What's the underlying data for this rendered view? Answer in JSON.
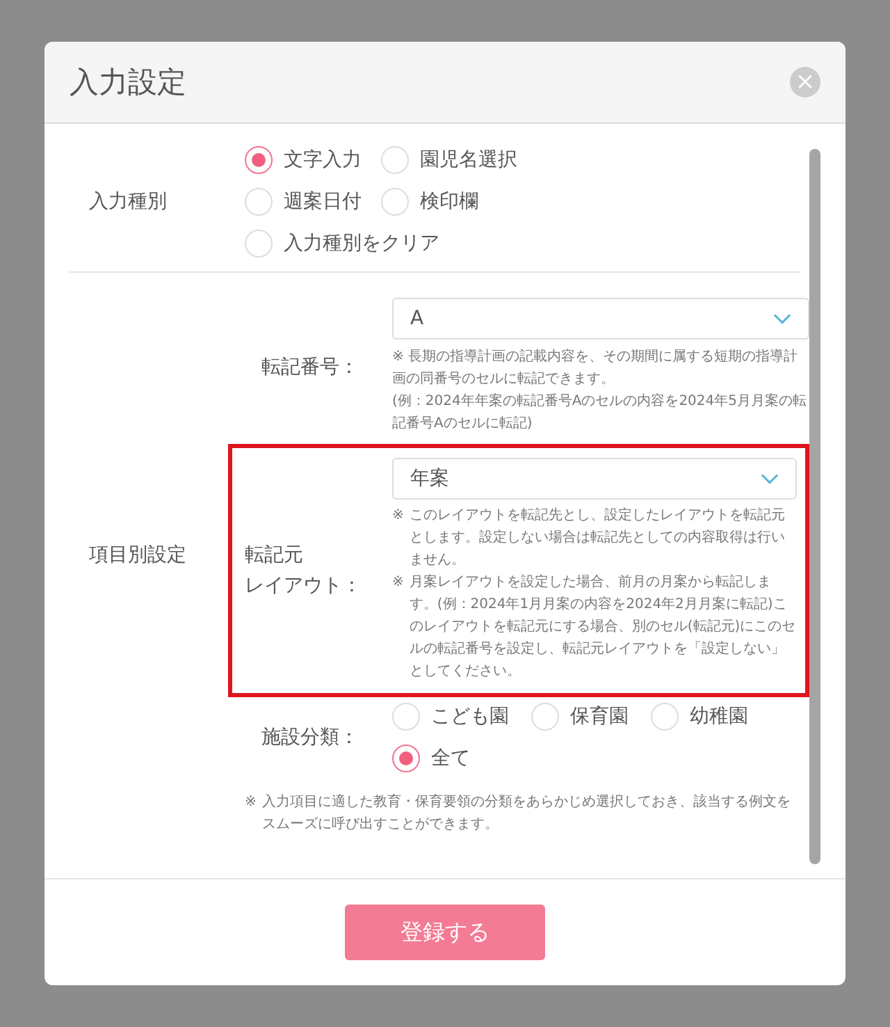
{
  "dialog": {
    "title": "入力設定",
    "close_icon": "×"
  },
  "input_type": {
    "label": "入力種別",
    "options": [
      {
        "label": "文字入力",
        "selected": true
      },
      {
        "label": "園児名選択",
        "selected": false
      },
      {
        "label": "週案日付",
        "selected": false
      },
      {
        "label": "検印欄",
        "selected": false
      },
      {
        "label": "入力種別をクリア",
        "selected": false
      }
    ]
  },
  "item_settings": {
    "label": "項目別設定",
    "transfer_number": {
      "label": "転記番号：",
      "value": "A",
      "notes": [
        "※ 長期の指導計画の記載内容を、その期間に属する短期の指導計画の同番号のセルに転記できます。",
        "(例：2024年年案の転記番号Aのセルの内容を2024年5月月案の転記番号Aのセルに転記)"
      ]
    },
    "source_layout": {
      "label_lines": [
        "転記元",
        "レイアウト："
      ],
      "value": "年案",
      "highlighted": true,
      "notes": [
        {
          "mark": "※",
          "text": "このレイアウトを転記先とし、設定したレイアウトを転記元とします。設定しない場合は転記先としての内容取得は行いません。"
        },
        {
          "mark": "※",
          "text": "月案レイアウトを設定した場合、前月の月案から転記します。(例：2024年1月月案の内容を2024年2月月案に転記)このレイアウトを転記元にする場合、別のセル(転記元)にこのセルの転記番号を設定し、転記元レイアウトを「設定しない」としてください。"
        }
      ]
    },
    "facility": {
      "label": "施設分類：",
      "options": [
        {
          "label": "こども園",
          "selected": false
        },
        {
          "label": "保育園",
          "selected": false
        },
        {
          "label": "幼稚園",
          "selected": false
        },
        {
          "label": "全て",
          "selected": true
        }
      ]
    },
    "note": {
      "mark": "※",
      "text": "入力項目に適した教育・保育要領の分類をあらかじめ選択しておき、該当する例文をスムーズに呼び出すことができます。"
    }
  },
  "footer": {
    "submit": "登録する"
  }
}
